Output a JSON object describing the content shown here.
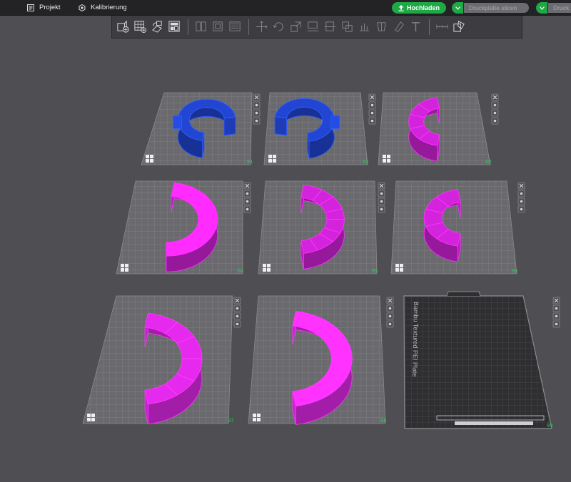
{
  "topbar": {
    "project_label": "Projekt",
    "calibration_label": "Kalibrierung",
    "upload_label": "Hochladen",
    "slice_plate_label": "Druckplatte slicen",
    "print_plate_label": "Druck"
  },
  "toolbar": {
    "tools": [
      {
        "icon": "add-object-icon",
        "active": true
      },
      {
        "icon": "add-plate-icon",
        "active": true
      },
      {
        "icon": "auto-orient-icon",
        "active": true
      },
      {
        "icon": "arrange-icon",
        "active": true
      },
      {
        "icon": "split-objects-icon",
        "active": false
      },
      {
        "icon": "split-parts-icon",
        "active": false
      },
      {
        "icon": "variable-layer-icon",
        "active": false
      },
      {
        "icon": "move-icon",
        "active": false
      },
      {
        "icon": "rotate-icon",
        "active": false
      },
      {
        "icon": "scale-icon",
        "active": false
      },
      {
        "icon": "lay-on-face-icon",
        "active": false
      },
      {
        "icon": "cut-icon",
        "active": false
      },
      {
        "icon": "mesh-boolean-icon",
        "active": false
      },
      {
        "icon": "support-paint-icon",
        "active": false
      },
      {
        "icon": "seam-paint-icon",
        "active": false
      },
      {
        "icon": "color-paint-icon",
        "active": false
      },
      {
        "icon": "text-icon",
        "active": false
      },
      {
        "icon": "measure-icon",
        "active": false
      },
      {
        "icon": "assembly-icon",
        "active": true
      }
    ]
  },
  "plates": [
    {
      "number": "01",
      "object_color": "#1f3fc0",
      "object_type": "c-ring-blue"
    },
    {
      "number": "02",
      "object_color": "#1f3fc0",
      "object_type": "c-ring-blue-mirrored"
    },
    {
      "number": "03",
      "object_color": "#c020c8",
      "object_type": "arc-segmented"
    },
    {
      "number": "04",
      "object_color": "#c020c8",
      "object_type": "arc-open"
    },
    {
      "number": "05",
      "object_color": "#c020c8",
      "object_type": "arc-dense"
    },
    {
      "number": "06",
      "object_color": "#c020c8",
      "object_type": "arc-segmented"
    },
    {
      "number": "07",
      "object_color": "#d025d8",
      "object_type": "arc-large-segmented"
    },
    {
      "number": "08",
      "object_color": "#d025d8",
      "object_type": "arc-large-open"
    },
    {
      "number": "09",
      "object_color": "#3b3b3e",
      "object_type": "empty-textured-plate"
    }
  ],
  "plate9_label": "Bambu Textured PEI Plate",
  "colors": {
    "accent": "#1fa846",
    "blue_filament": "#1f3fc0",
    "magenta_filament": "#c020c8",
    "plate_number": "#1fcf56"
  }
}
